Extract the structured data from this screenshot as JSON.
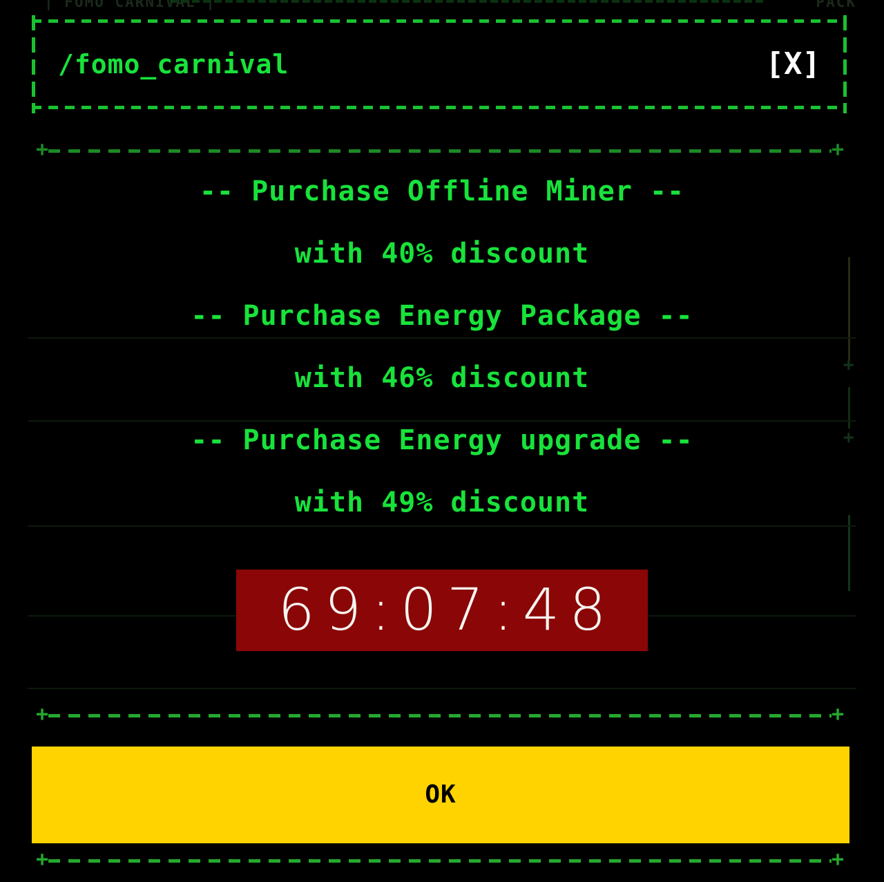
{
  "window": {
    "title": "/fomo_carnival",
    "close_label": "[X]",
    "close_icon": "close-icon"
  },
  "background": {
    "top_text_left": "| FOMO CARNIVAL |",
    "top_text_right": "PACK"
  },
  "offers": [
    {
      "title": "-- Purchase Offline Miner --",
      "subtitle": "with 40% discount",
      "discount": "40%"
    },
    {
      "title": "-- Purchase Energy Package --",
      "subtitle": "with 46% discount",
      "discount": "46%"
    },
    {
      "title": "-- Purchase Energy upgrade --",
      "subtitle": "with 49% discount",
      "discount": "49%"
    }
  ],
  "timer": {
    "value": "69:07:48",
    "hours": "69",
    "minutes": "07",
    "seconds": "48"
  },
  "footer": {
    "ok_label": "OK"
  },
  "separators": {
    "plus": "+"
  },
  "colors": {
    "terminal_green": "#18e23b",
    "dim_green": "#1c8a24",
    "timer_background": "#8b0606",
    "timer_text": "#f5f5f0",
    "button_yellow": "#ffd300",
    "button_text": "#000000",
    "background": "#000000"
  }
}
